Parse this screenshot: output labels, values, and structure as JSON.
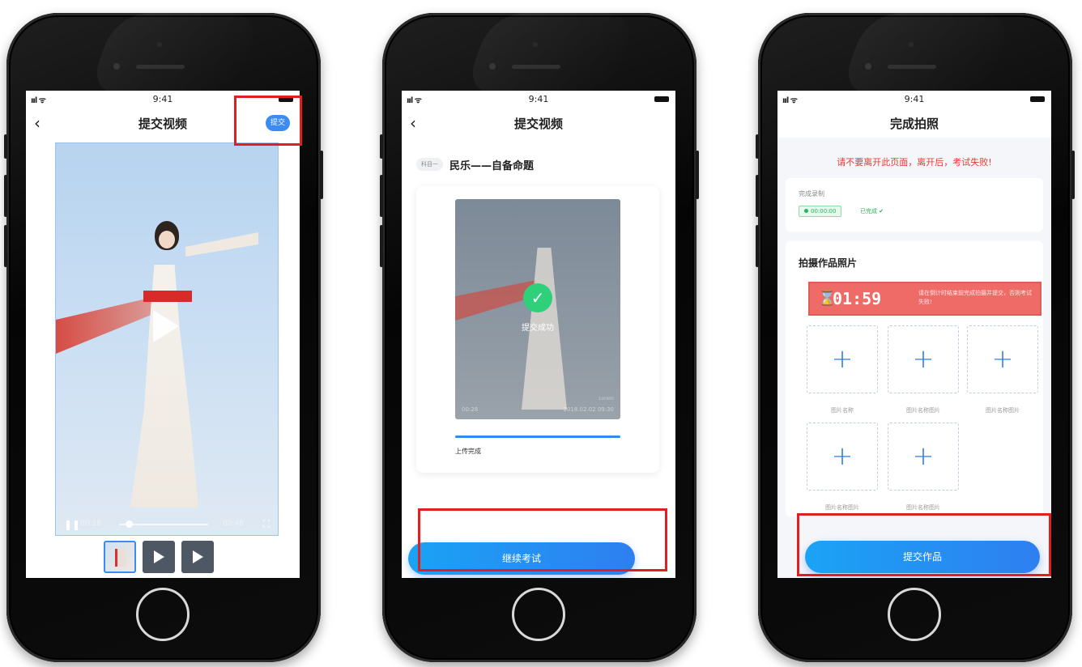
{
  "status": {
    "time": "9:41",
    "signal": "ııl",
    "wifi": "ᯤ"
  },
  "phone1": {
    "nav_title": "提交视频",
    "submit_label": "提交",
    "video": {
      "current_time": "00:28",
      "total_time": "02:48"
    }
  },
  "phone2": {
    "nav_title": "提交视频",
    "subject_tag": "科目一",
    "subject_name": "民乐——自备命题",
    "success_text": "提交成功",
    "meta_left": "00:28",
    "meta_right": "2018.02.02 09:30",
    "meta_top_right": "Lorem",
    "upload_progress": 1.0,
    "upload_label": "上传完成",
    "continue_label": "继续考试"
  },
  "phone3": {
    "nav_title": "完成拍照",
    "warning": "请不要离开此页面，离开后，考试失败!",
    "record_label": "完成录制",
    "record_time": "00:00:00",
    "record_done": "已完成 ✔",
    "photos_heading": "拍摄作品照片",
    "countdown": "01:59",
    "countdown_note": "请在倒计时结束前完成拍摄并提交，否则考试失败!",
    "tiles": [
      {
        "caption": "图片名称"
      },
      {
        "caption": "图片名称图片"
      },
      {
        "caption": "图片名称图片"
      },
      {
        "caption": "图片名称图片"
      },
      {
        "caption": "图片名称图片"
      }
    ],
    "submit_label": "提交作品"
  },
  "colors": {
    "accent": "#2f7cf0",
    "highlight": "#e02020",
    "success": "#2fd07a",
    "warning": "#e8382f"
  }
}
